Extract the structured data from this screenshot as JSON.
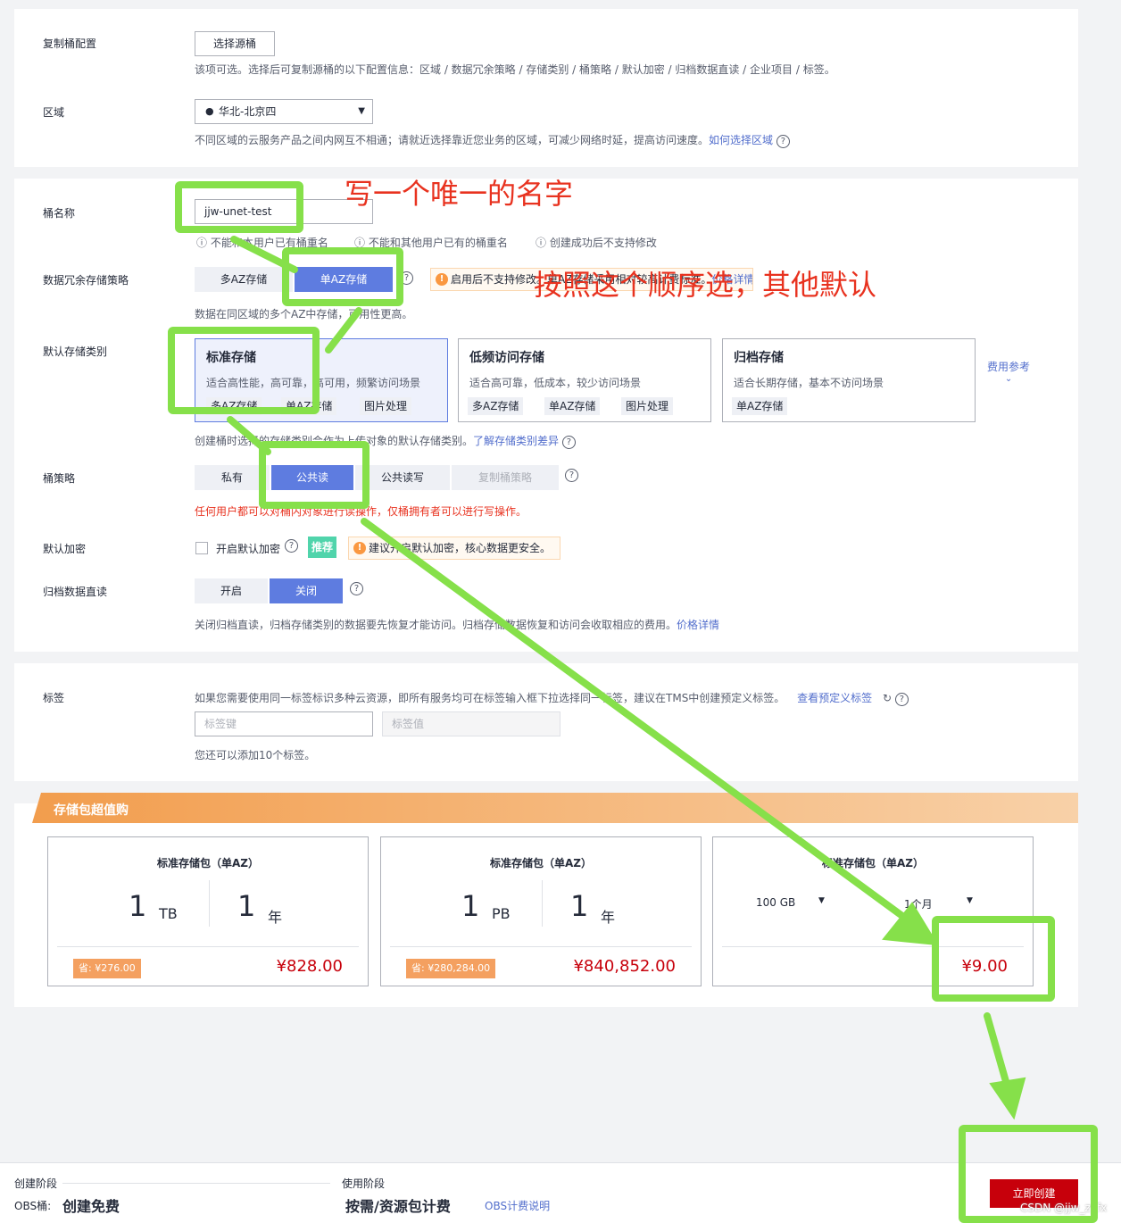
{
  "replicate": {
    "label": "复制桶配置",
    "button": "选择源桶",
    "help": "该项可选。选择后可复制源桶的以下配置信息：区域 / 数据冗余策略 / 存储类别 / 桶策略 / 默认加密 / 归档数据直读 / 企业项目 / 标签。"
  },
  "region": {
    "label": "区域",
    "value": "华北-北京四",
    "help": "不同区域的云服务产品之间内网互不相通；请就近选择靠近您业务的区域，可减少网络时延，提高访问速度。",
    "link": "如何选择区域"
  },
  "bucket_name": {
    "label": "桶名称",
    "value": "jjw-unet-test",
    "hints": [
      "不能和本用户已有桶重名",
      "不能和其他用户已有的桶重名",
      "创建成功后不支持修改"
    ]
  },
  "redundancy": {
    "label": "数据冗余存储策略",
    "options": [
      "多AZ存储",
      "单AZ存储"
    ],
    "selected": "单AZ存储",
    "warning": "启用后不支持修改。单AZ存储采用相对较高计费标准。",
    "warning_link": "价格详情",
    "help": "数据在同区域的多个AZ中存储，可用性更高。"
  },
  "storage_class": {
    "label": "默认存储类别",
    "cost_link": "费用参考",
    "help": "创建桶时选择的存储类别会作为上传对象的默认存储类别。",
    "help_link": "了解存储类别差异",
    "types": [
      {
        "title": "标准存储",
        "desc": "适合高性能，高可靠，高可用，频繁访问场景",
        "tags": [
          "多AZ存储",
          "单AZ存储",
          "图片处理"
        ]
      },
      {
        "title": "低频访问存储",
        "desc": "适合高可靠，低成本，较少访问场景",
        "tags": [
          "多AZ存储",
          "单AZ存储",
          "图片处理"
        ]
      },
      {
        "title": "归档存储",
        "desc": "适合长期存储，基本不访问场景",
        "tags": [
          "单AZ存储"
        ]
      }
    ]
  },
  "bucket_policy": {
    "label": "桶策略",
    "options": [
      "私有",
      "公共读",
      "公共读写",
      "复制桶策略"
    ],
    "selected": "公共读",
    "help": "任何用户都可以对桶内对象进行读操作，仅桶拥有者可以进行写操作。"
  },
  "encryption": {
    "label": "默认加密",
    "checkbox": "开启默认加密",
    "badge": "推荐",
    "warning": "建议开启默认加密，核心数据更安全。"
  },
  "archive": {
    "label": "归档数据直读",
    "options": [
      "开启",
      "关闭"
    ],
    "selected": "关闭",
    "help": "关闭归档直读，归档存储类别的数据要先恢复才能访问。归档存储数据恢复和访问会收取相应的费用。",
    "link": "价格详情"
  },
  "tags": {
    "label": "标签",
    "help": "如果您需要使用同一标签标识多种云资源，即所有服务均可在标签输入框下拉选择同一标签，建议在TMS中创建预定义标签。",
    "link": "查看预定义标签",
    "key_placeholder": "标签键",
    "value_placeholder": "标签值",
    "limit": "您还可以添加10个标签。"
  },
  "packages": {
    "header": "存储包超值购",
    "items": [
      {
        "title": "标准存储包（单AZ）",
        "size": "1",
        "size_unit": "TB",
        "period": "1",
        "period_unit": "年",
        "save": "省: ¥276.00",
        "price": "¥828.00"
      },
      {
        "title": "标准存储包（单AZ）",
        "size": "1",
        "size_unit": "PB",
        "period": "1",
        "period_unit": "年",
        "save": "省: ¥280,284.00",
        "price": "¥840,852.00"
      },
      {
        "title": "标准存储包（单AZ）",
        "size_select": "100 GB",
        "period_select": "1个月",
        "price": "¥9.00"
      }
    ]
  },
  "footer": {
    "stage1_label": "创建阶段",
    "obs_label": "OBS桶:",
    "stage1_value": "创建免费",
    "stage2_label": "使用阶段",
    "stage2_value": "按需/资源包计费",
    "billing_link": "OBS计费说明",
    "create_button": "立即创建",
    "watermark": "CSDN @jjw_zyfx"
  },
  "annotations": {
    "name_note": "写一个唯一的名字",
    "order_note": "按照这个顺序选，其他默认"
  },
  "colors": {
    "accent": "#5e7ce0",
    "annotation": "#86e04a",
    "danger": "#c7000b",
    "note": "#e8321f"
  }
}
